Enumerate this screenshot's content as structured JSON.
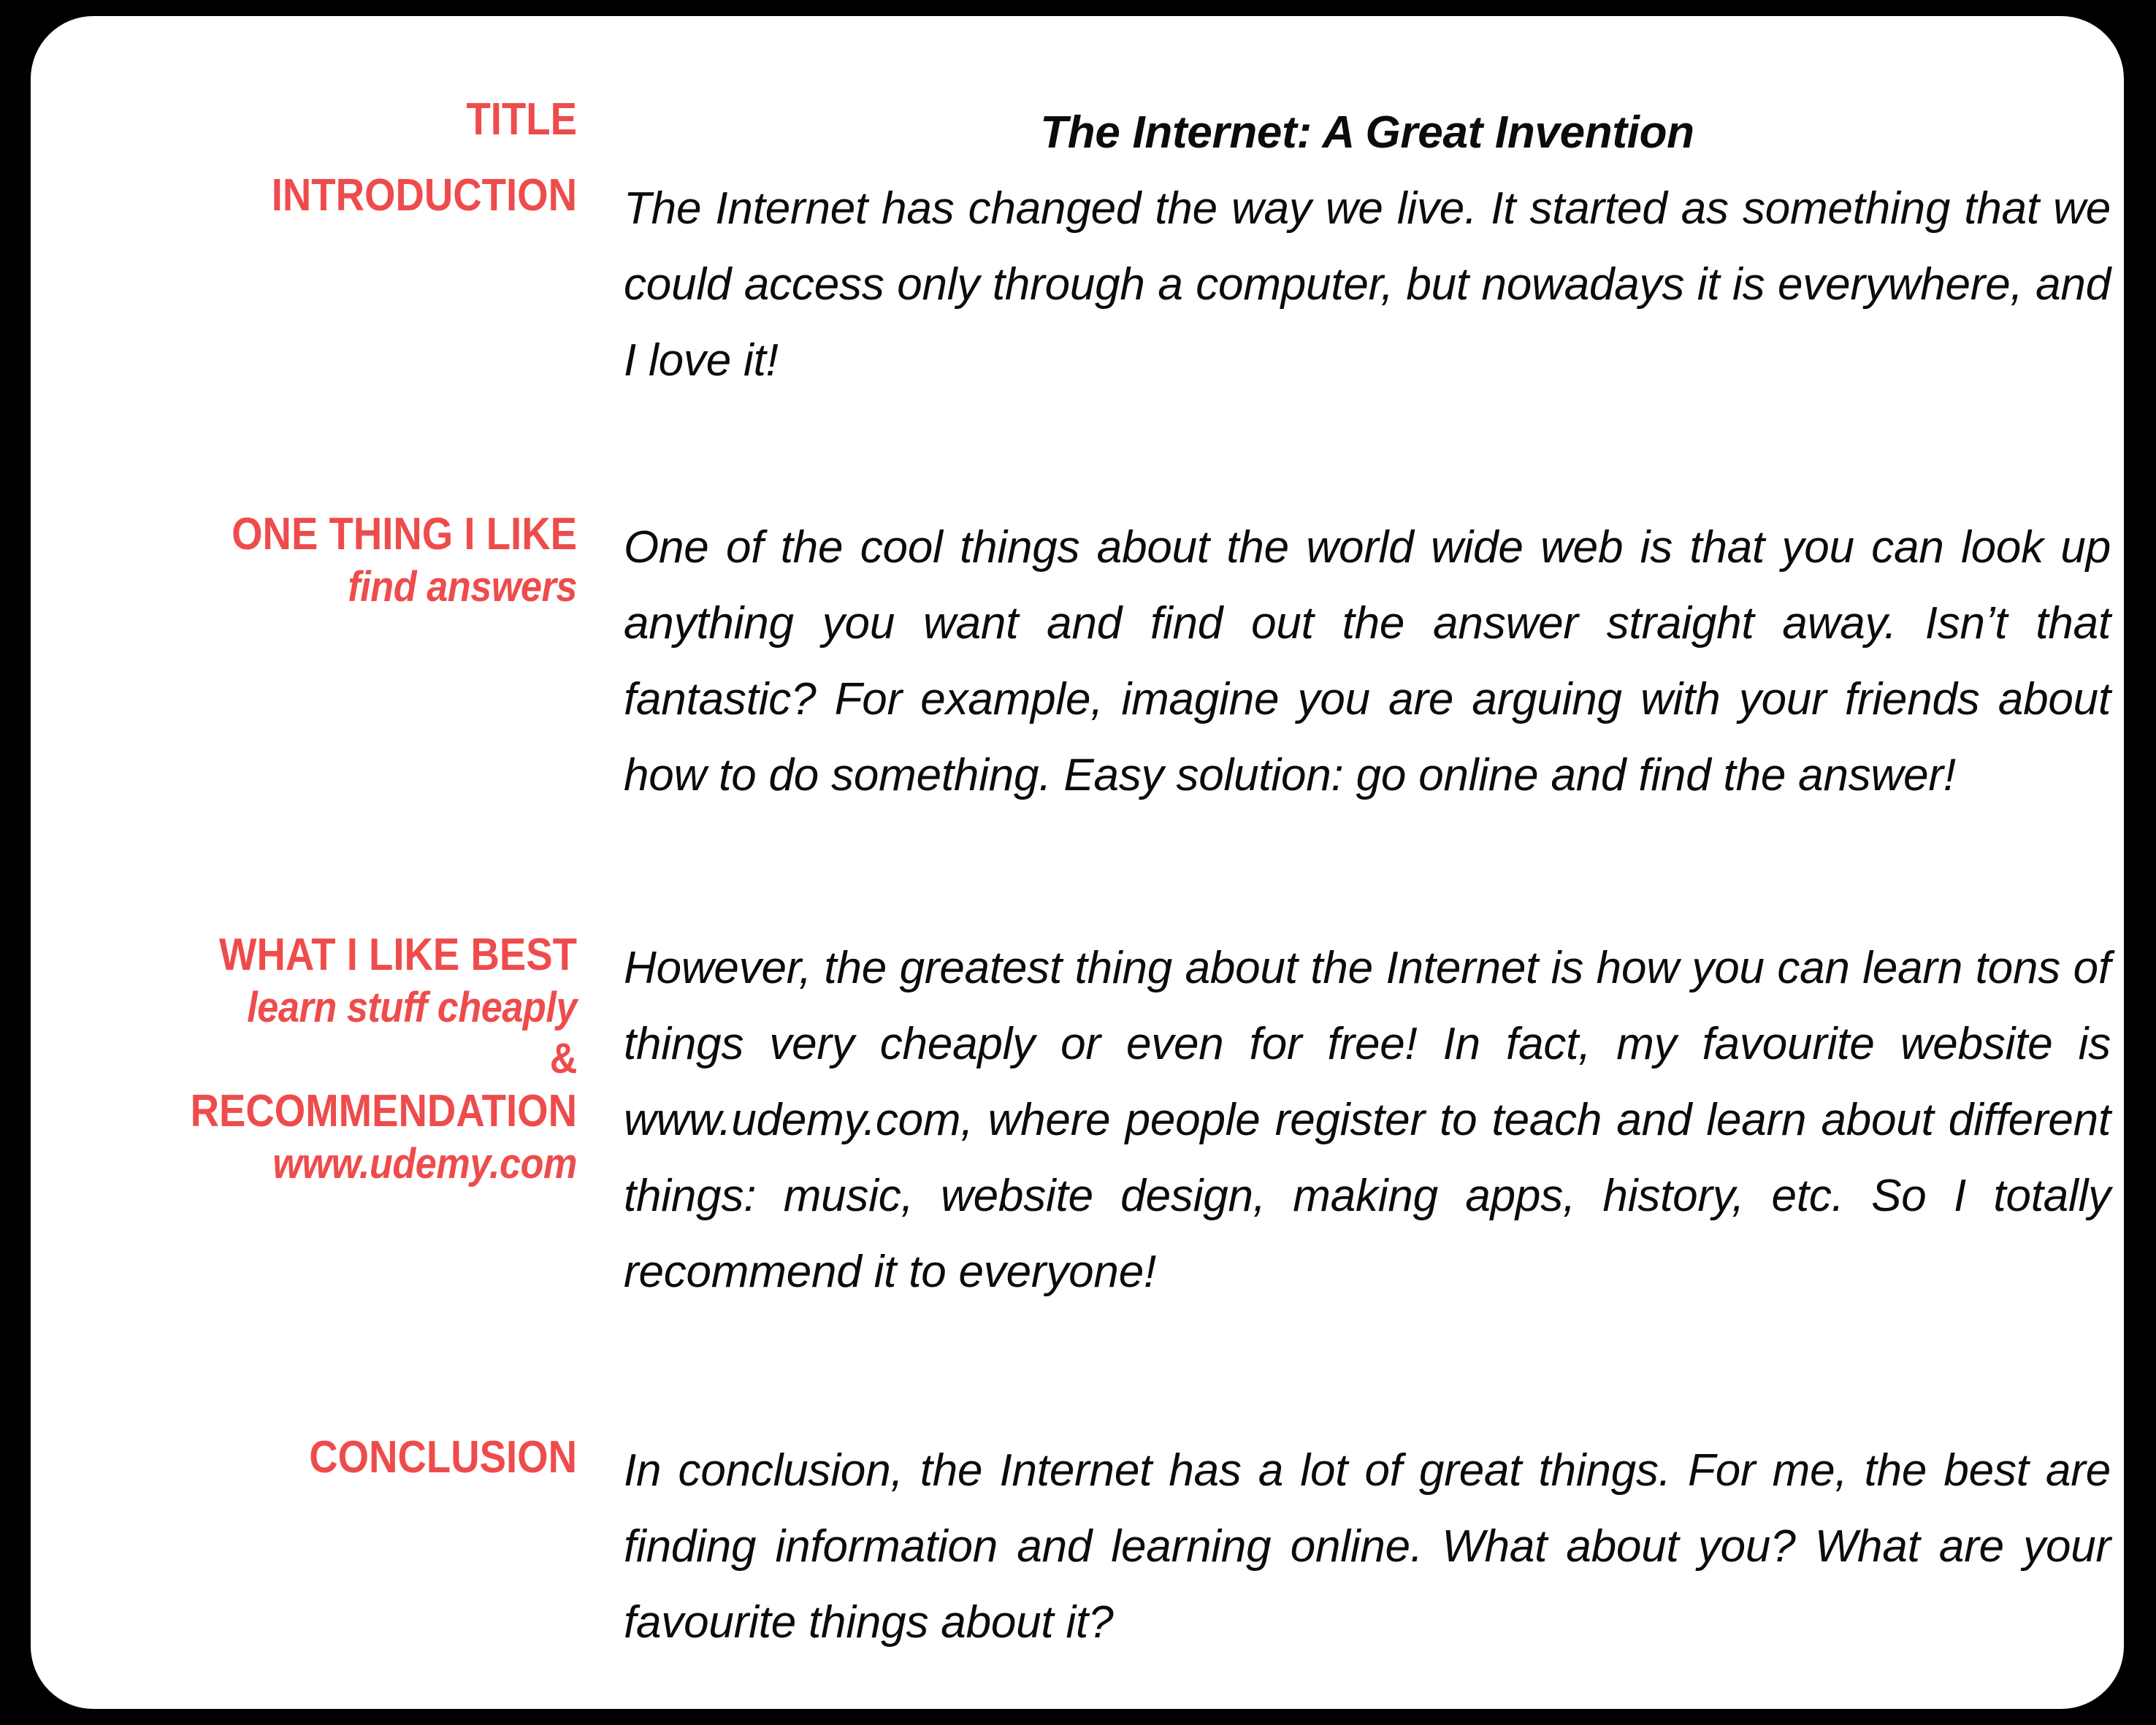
{
  "card": {
    "background_color": "#ffffff",
    "page_background_color": "#000000",
    "accent_color": "#ee4c4c",
    "text_color": "#0b0b0b"
  },
  "document": {
    "title": "The Internet: A Great Invention"
  },
  "sections": [
    {
      "id": "title",
      "labels": [
        "TITLE"
      ],
      "body": "The Internet: A Great Invention"
    },
    {
      "id": "introduction",
      "labels": [
        "INTRODUCTION"
      ],
      "body": "The Internet has changed the way we live. It started as something that we could access only through a computer, but nowadays it is everywhere, and I love it!"
    },
    {
      "id": "one-thing-i-like",
      "labels": [
        "ONE THING I LIKE",
        "find answers"
      ],
      "body": "One of the cool things about the world wide web is that you can look up anything you want and find out the answer straight away. Isn’t that fantastic? For example, imagine you are arguing with your friends about how to do something. Easy solution: go online and find the answer!"
    },
    {
      "id": "what-i-like-best",
      "labels": [
        "WHAT I LIKE BEST",
        "learn stuff  cheaply",
        "&",
        "RECOMMENDATION",
        "www.udemy.com"
      ],
      "body": "However, the greatest thing about the Internet is how you can learn tons of things very cheaply or even for free! In fact, my favourite website is www.udemy.com, where people register to teach and learn about different things: music, website design, making apps, history, etc. So I totally recommend it to everyone!"
    },
    {
      "id": "conclusion",
      "labels": [
        "CONCLUSION"
      ],
      "body": "In conclusion, the Internet has a lot of great things. For me, the best are finding information and learning online. What about you? What are your favourite things about it?"
    }
  ],
  "labels": {
    "title": "TITLE",
    "introduction": "INTRODUCTION",
    "one_thing_i_like": "ONE THING I LIKE",
    "find_answers": "find answers",
    "what_i_like_best": "WHAT I LIKE BEST",
    "learn_stuff_cheaply": "learn stuff  cheaply",
    "ampersand": "&",
    "recommendation": "RECOMMENDATION",
    "udemy_url": "www.udemy.com",
    "conclusion": "CONCLUSION"
  },
  "body_text": {
    "title_line": "The Internet: A Great Invention",
    "introduction": "The Internet has changed the way we live. It started as something that we could access only through a computer, but nowadays it is everywhere, and I love it!",
    "one_thing_i_like": "One of the cool things about the world wide web is that you can look up anything you want and find out the answer straight away. Isn’t that fantastic? For example, imagine you are arguing with your friends about how to do something. Easy solution: go online and find the answer!",
    "what_i_like_best": "However, the greatest thing about the Internet is how you can learn tons of things very cheaply or even for free! In fact, my favourite website is www.udemy.com, where people register to teach and learn about different things: music, website design, making apps, history, etc. So I totally recommend it to everyone!",
    "conclusion": "In conclusion, the Internet has a lot of great things. For me, the best are finding information and learning online. What about you? What are your favourite things about it?"
  }
}
